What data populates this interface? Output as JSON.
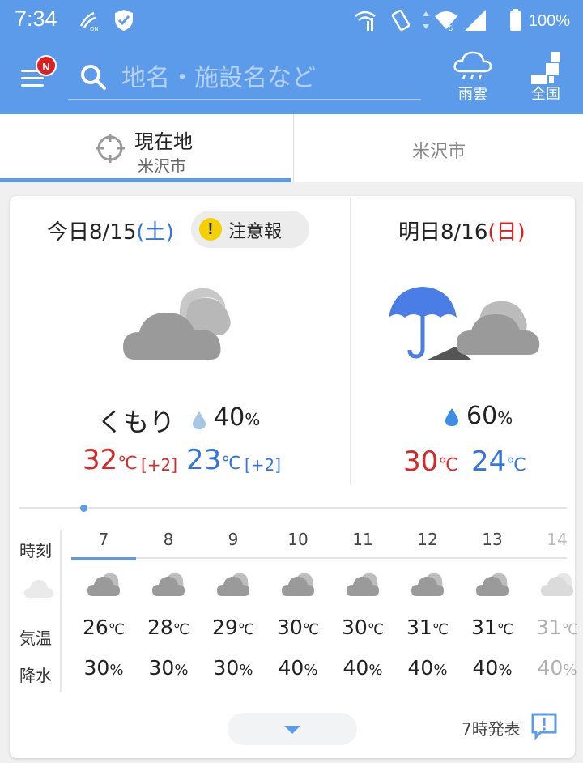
{
  "status_bar": {
    "time": "7:34",
    "battery": "100%",
    "icons": [
      "nfc-icon",
      "shield-check-icon",
      "wifi-call-icon",
      "vibrate-icon",
      "signal-icon",
      "battery-icon"
    ]
  },
  "header": {
    "menu_badge": "N",
    "search_placeholder": "地名・施設名など",
    "rain_cloud_label": "雨雲",
    "nationwide_label": "全国"
  },
  "tabs": {
    "current_title": "現在地",
    "current_sub": "米沢市",
    "other_city": "米沢市"
  },
  "today": {
    "date": "今日8/15",
    "day_open": "(",
    "day": "土",
    "day_close": ")",
    "alert": "注意報",
    "weather": "くもり",
    "pop": "40",
    "pop_unit": "%",
    "high": "32",
    "high_unit": "℃",
    "high_diff": "[+2]",
    "low": "23",
    "low_unit": "℃",
    "low_diff": "[+2]"
  },
  "tomorrow": {
    "date": "明日8/16",
    "day_open": "(",
    "day": "日",
    "day_close": ")",
    "pop": "60",
    "pop_unit": "%",
    "high": "30",
    "high_unit": "℃",
    "low": "24",
    "low_unit": "℃"
  },
  "hourly": {
    "label_time": "時刻",
    "label_temp": "気温",
    "label_precip": "降水",
    "hours": [
      "7",
      "8",
      "9",
      "10",
      "11",
      "12",
      "13",
      "14"
    ],
    "temps": [
      "26",
      "28",
      "29",
      "30",
      "30",
      "31",
      "31",
      "31"
    ],
    "temp_unit": "℃",
    "precip": [
      "30",
      "30",
      "30",
      "40",
      "40",
      "40",
      "40",
      "40"
    ],
    "precip_unit": "%"
  },
  "footer": {
    "issued": "7時発表"
  },
  "colors": {
    "brand_blue": "#5b9bea",
    "high_red": "#d8282a",
    "low_blue": "#3574e0",
    "alert_yellow": "#f4d000"
  }
}
